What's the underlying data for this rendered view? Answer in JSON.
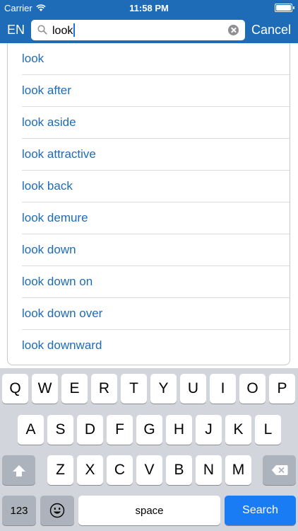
{
  "status_bar": {
    "carrier": "Carrier",
    "time": "11:58 PM"
  },
  "search_bar": {
    "language": "EN",
    "query": "look",
    "cancel_label": "Cancel"
  },
  "suggestions": [
    "look",
    "look after",
    "look aside",
    "look attractive",
    "look back",
    "look demure",
    "look down",
    "look down on",
    "look down over",
    "look downward"
  ],
  "keyboard": {
    "row1": [
      "Q",
      "W",
      "E",
      "R",
      "T",
      "Y",
      "U",
      "I",
      "O",
      "P"
    ],
    "row2": [
      "A",
      "S",
      "D",
      "F",
      "G",
      "H",
      "J",
      "K",
      "L"
    ],
    "row3": [
      "Z",
      "X",
      "C",
      "V",
      "B",
      "N",
      "M"
    ],
    "numbers_label": "123",
    "space_label": "space",
    "search_label": "Search"
  },
  "colors": {
    "header": "#1e6bb8",
    "link": "#1e6bb8",
    "search_key": "#1a7cf5"
  },
  "icons": [
    "wifi-icon",
    "battery-icon",
    "search-icon",
    "clear-icon",
    "shift-icon",
    "delete-icon",
    "emoji-icon"
  ]
}
